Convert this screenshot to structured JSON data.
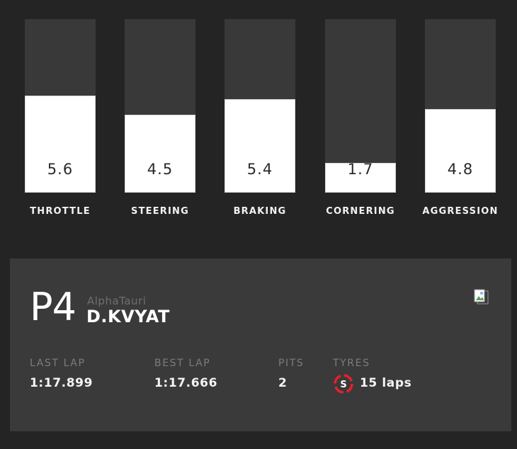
{
  "bars": [
    {
      "label": "THROTTLE",
      "value": "5.6",
      "fraction": 0.56
    },
    {
      "label": "STEERING",
      "value": "4.5",
      "fraction": 0.45
    },
    {
      "label": "BRAKING",
      "value": "5.4",
      "fraction": 0.54
    },
    {
      "label": "CORNERING",
      "value": "1.7",
      "fraction": 0.17
    },
    {
      "label": "AGGRESSION",
      "value": "4.8",
      "fraction": 0.48
    }
  ],
  "driver": {
    "position": "P4",
    "team": "AlphaTauri",
    "name": "D.KVYAT",
    "team_logo_icon": "broken-image-icon"
  },
  "stats": {
    "last_lap_label": "LAST LAP",
    "last_lap": "1:17.899",
    "best_lap_label": "BEST LAP",
    "best_lap": "1:17.666",
    "pits_label": "PITS",
    "pits": "2",
    "tyres_label": "TYRES",
    "tyre_compound": "S",
    "tyre_laps": "15 laps",
    "tyre_icon": "soft-tyre-icon",
    "tyre_color": "#e8202a"
  },
  "colors": {
    "background": "#242424",
    "card": "#3a3a3a",
    "track": "#393939",
    "fill": "#ffffff"
  }
}
